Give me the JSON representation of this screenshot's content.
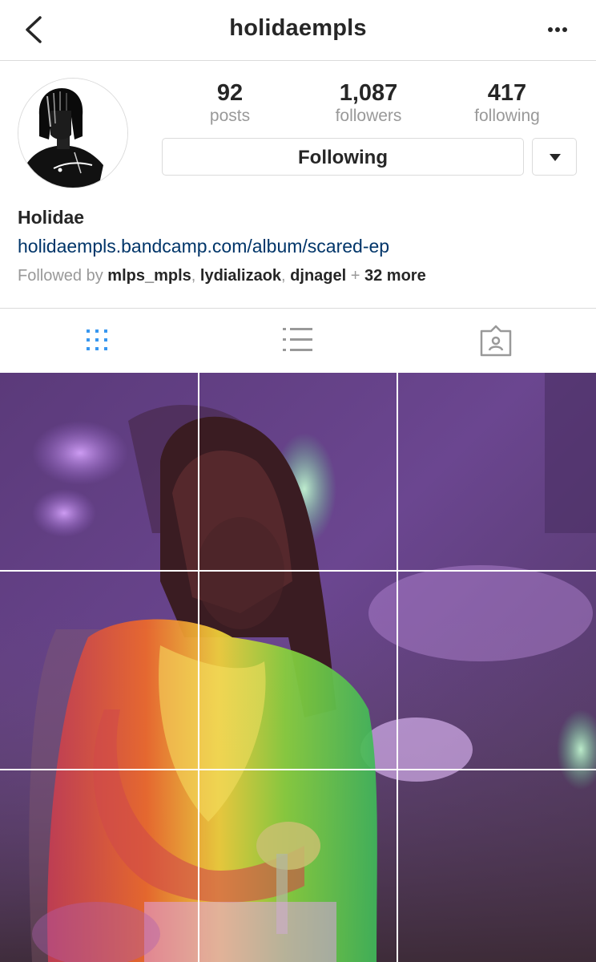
{
  "header": {
    "title": "holidaempls",
    "back_icon": "chevron-left-icon",
    "more_icon": "more-horizontal-icon"
  },
  "profile": {
    "stats": [
      {
        "value": "92",
        "label": "posts"
      },
      {
        "value": "1,087",
        "label": "followers"
      },
      {
        "value": "417",
        "label": "following"
      }
    ],
    "follow_button_label": "Following",
    "display_name": "Holidae",
    "website": "holidaempls.bandcamp.com/album/scared-ep",
    "followed_by": {
      "prefix": "Followed by ",
      "users": [
        "mlps_mpls",
        "lydializaok",
        "djnagel"
      ],
      "sep": ", ",
      "plus": " + ",
      "more": "32 more"
    }
  },
  "tabs": {
    "items": [
      "grid-icon",
      "list-icon",
      "tagged-icon"
    ],
    "active": "grid-icon",
    "active_color": "#3897f0",
    "inactive_color": "#999999"
  },
  "colors": {
    "link": "#003569",
    "border": "#dbdbdb",
    "muted": "#999999",
    "text": "#262626"
  }
}
